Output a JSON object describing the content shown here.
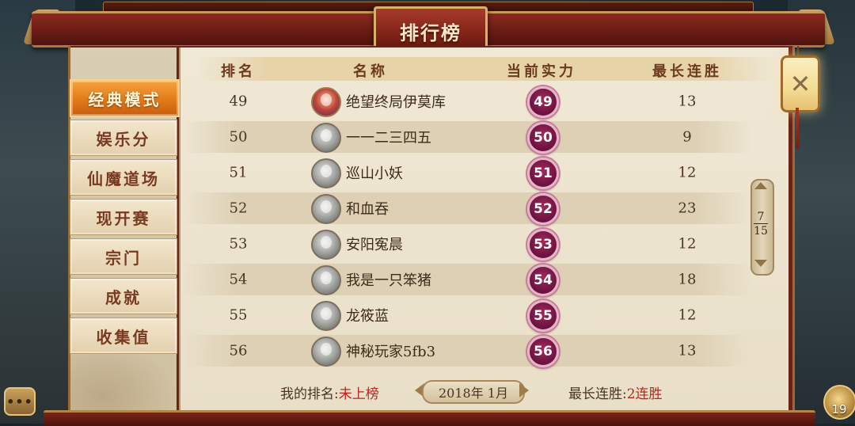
{
  "title": "排行榜",
  "sidebar": {
    "items": [
      {
        "label": "经典模式"
      },
      {
        "label": "娱乐分"
      },
      {
        "label": "仙魔道场"
      },
      {
        "label": "现开赛"
      },
      {
        "label": "宗门"
      },
      {
        "label": "成就"
      },
      {
        "label": "收集值"
      }
    ],
    "active_index": 0
  },
  "table": {
    "columns": [
      "排名",
      "名称",
      "当前实力",
      "最长连胜"
    ],
    "rows": [
      {
        "rank": "49",
        "name": "绝望终局伊莫库",
        "power": "49",
        "streak": "13"
      },
      {
        "rank": "50",
        "name": "一一二三四五",
        "power": "50",
        "streak": "9"
      },
      {
        "rank": "51",
        "name": "巡山小妖",
        "power": "51",
        "streak": "12"
      },
      {
        "rank": "52",
        "name": "和血吞",
        "power": "52",
        "streak": "23"
      },
      {
        "rank": "53",
        "name": "安阳寃晨",
        "power": "53",
        "streak": "12"
      },
      {
        "rank": "54",
        "name": "我是一只笨猪",
        "power": "54",
        "streak": "18"
      },
      {
        "rank": "55",
        "name": "龙筱蓝",
        "power": "55",
        "streak": "12"
      },
      {
        "rank": "56",
        "name": "神秘玩家5fb3",
        "power": "56",
        "streak": "13"
      }
    ]
  },
  "footer": {
    "my_rank_label": "我的排名:",
    "my_rank_value": "未上榜",
    "date": "2018年 1月",
    "streak_label": "最长连胜:",
    "streak_value": "2连胜"
  },
  "pager": {
    "current": "7",
    "total": "15"
  },
  "close_glyph": "✕",
  "chat_glyph": "•••",
  "coin_count": "19",
  "colors": {
    "accent_orange": "#e27a18",
    "beam_red": "#6e1d15",
    "highlight_red": "#c0221a",
    "badge_magenta": "#a12a5a"
  }
}
